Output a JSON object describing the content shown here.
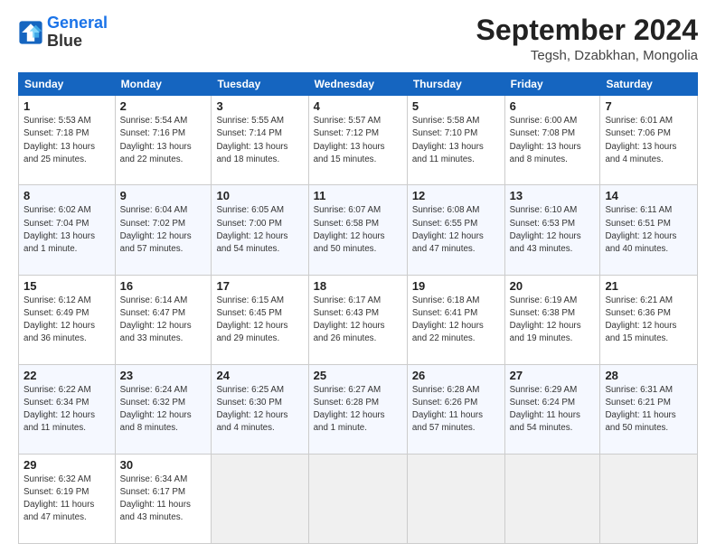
{
  "logo": {
    "line1": "General",
    "line2": "Blue"
  },
  "header": {
    "month_title": "September 2024",
    "subtitle": "Tegsh, Dzabkhan, Mongolia"
  },
  "weekdays": [
    "Sunday",
    "Monday",
    "Tuesday",
    "Wednesday",
    "Thursday",
    "Friday",
    "Saturday"
  ],
  "weeks": [
    [
      {
        "day": "1",
        "info": "Sunrise: 5:53 AM\nSunset: 7:18 PM\nDaylight: 13 hours\nand 25 minutes."
      },
      {
        "day": "2",
        "info": "Sunrise: 5:54 AM\nSunset: 7:16 PM\nDaylight: 13 hours\nand 22 minutes."
      },
      {
        "day": "3",
        "info": "Sunrise: 5:55 AM\nSunset: 7:14 PM\nDaylight: 13 hours\nand 18 minutes."
      },
      {
        "day": "4",
        "info": "Sunrise: 5:57 AM\nSunset: 7:12 PM\nDaylight: 13 hours\nand 15 minutes."
      },
      {
        "day": "5",
        "info": "Sunrise: 5:58 AM\nSunset: 7:10 PM\nDaylight: 13 hours\nand 11 minutes."
      },
      {
        "day": "6",
        "info": "Sunrise: 6:00 AM\nSunset: 7:08 PM\nDaylight: 13 hours\nand 8 minutes."
      },
      {
        "day": "7",
        "info": "Sunrise: 6:01 AM\nSunset: 7:06 PM\nDaylight: 13 hours\nand 4 minutes."
      }
    ],
    [
      {
        "day": "8",
        "info": "Sunrise: 6:02 AM\nSunset: 7:04 PM\nDaylight: 13 hours\nand 1 minute."
      },
      {
        "day": "9",
        "info": "Sunrise: 6:04 AM\nSunset: 7:02 PM\nDaylight: 12 hours\nand 57 minutes."
      },
      {
        "day": "10",
        "info": "Sunrise: 6:05 AM\nSunset: 7:00 PM\nDaylight: 12 hours\nand 54 minutes."
      },
      {
        "day": "11",
        "info": "Sunrise: 6:07 AM\nSunset: 6:58 PM\nDaylight: 12 hours\nand 50 minutes."
      },
      {
        "day": "12",
        "info": "Sunrise: 6:08 AM\nSunset: 6:55 PM\nDaylight: 12 hours\nand 47 minutes."
      },
      {
        "day": "13",
        "info": "Sunrise: 6:10 AM\nSunset: 6:53 PM\nDaylight: 12 hours\nand 43 minutes."
      },
      {
        "day": "14",
        "info": "Sunrise: 6:11 AM\nSunset: 6:51 PM\nDaylight: 12 hours\nand 40 minutes."
      }
    ],
    [
      {
        "day": "15",
        "info": "Sunrise: 6:12 AM\nSunset: 6:49 PM\nDaylight: 12 hours\nand 36 minutes."
      },
      {
        "day": "16",
        "info": "Sunrise: 6:14 AM\nSunset: 6:47 PM\nDaylight: 12 hours\nand 33 minutes."
      },
      {
        "day": "17",
        "info": "Sunrise: 6:15 AM\nSunset: 6:45 PM\nDaylight: 12 hours\nand 29 minutes."
      },
      {
        "day": "18",
        "info": "Sunrise: 6:17 AM\nSunset: 6:43 PM\nDaylight: 12 hours\nand 26 minutes."
      },
      {
        "day": "19",
        "info": "Sunrise: 6:18 AM\nSunset: 6:41 PM\nDaylight: 12 hours\nand 22 minutes."
      },
      {
        "day": "20",
        "info": "Sunrise: 6:19 AM\nSunset: 6:38 PM\nDaylight: 12 hours\nand 19 minutes."
      },
      {
        "day": "21",
        "info": "Sunrise: 6:21 AM\nSunset: 6:36 PM\nDaylight: 12 hours\nand 15 minutes."
      }
    ],
    [
      {
        "day": "22",
        "info": "Sunrise: 6:22 AM\nSunset: 6:34 PM\nDaylight: 12 hours\nand 11 minutes."
      },
      {
        "day": "23",
        "info": "Sunrise: 6:24 AM\nSunset: 6:32 PM\nDaylight: 12 hours\nand 8 minutes."
      },
      {
        "day": "24",
        "info": "Sunrise: 6:25 AM\nSunset: 6:30 PM\nDaylight: 12 hours\nand 4 minutes."
      },
      {
        "day": "25",
        "info": "Sunrise: 6:27 AM\nSunset: 6:28 PM\nDaylight: 12 hours\nand 1 minute."
      },
      {
        "day": "26",
        "info": "Sunrise: 6:28 AM\nSunset: 6:26 PM\nDaylight: 11 hours\nand 57 minutes."
      },
      {
        "day": "27",
        "info": "Sunrise: 6:29 AM\nSunset: 6:24 PM\nDaylight: 11 hours\nand 54 minutes."
      },
      {
        "day": "28",
        "info": "Sunrise: 6:31 AM\nSunset: 6:21 PM\nDaylight: 11 hours\nand 50 minutes."
      }
    ],
    [
      {
        "day": "29",
        "info": "Sunrise: 6:32 AM\nSunset: 6:19 PM\nDaylight: 11 hours\nand 47 minutes."
      },
      {
        "day": "30",
        "info": "Sunrise: 6:34 AM\nSunset: 6:17 PM\nDaylight: 11 hours\nand 43 minutes."
      },
      {
        "day": "",
        "info": ""
      },
      {
        "day": "",
        "info": ""
      },
      {
        "day": "",
        "info": ""
      },
      {
        "day": "",
        "info": ""
      },
      {
        "day": "",
        "info": ""
      }
    ]
  ]
}
